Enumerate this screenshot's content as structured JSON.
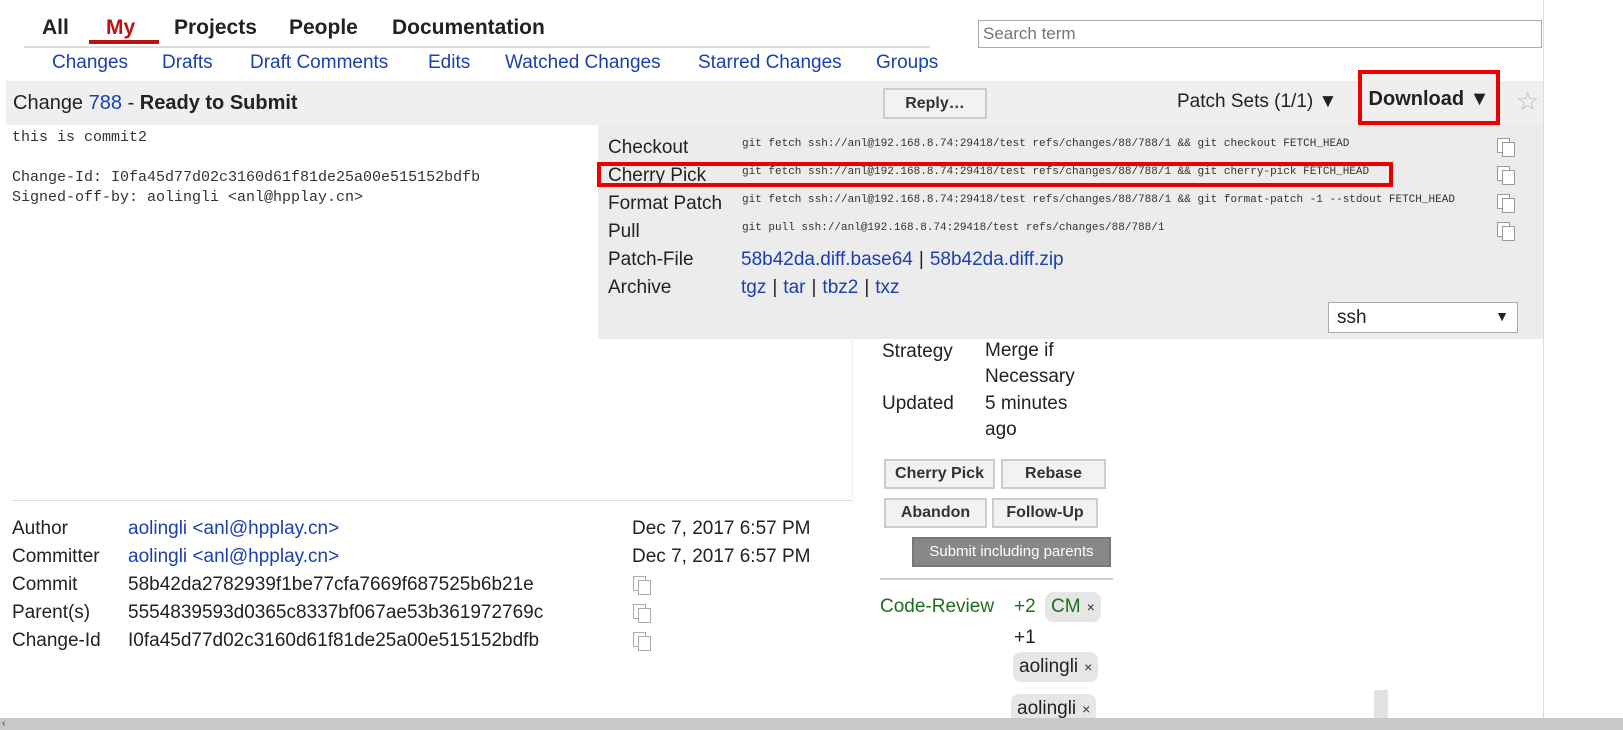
{
  "nav": {
    "tabs": [
      "All",
      "My",
      "Projects",
      "People",
      "Documentation"
    ],
    "active_tab": "My",
    "subtabs": [
      "Changes",
      "Drafts",
      "Draft Comments",
      "Edits",
      "Watched Changes",
      "Starred Changes",
      "Groups"
    ]
  },
  "search": {
    "placeholder": "Search term"
  },
  "change": {
    "label": "Change",
    "number": "788",
    "separator": "-",
    "status": "Ready to Submit",
    "reply_label": "Reply…",
    "patch_sets_label": "Patch Sets (1/1) ▼",
    "download_label": "Download ▼"
  },
  "commit_message": "this is commit2\n\nChange-Id: I0fa45d77d02c3160d61f81de25a00e515152bdfb\nSigned-off-by: aolingli <anl@hpplay.cn>",
  "download": {
    "rows": [
      {
        "label": "Checkout",
        "command": "git fetch ssh://anl@192.168.8.74:29418/test refs/changes/88/788/1 && git checkout FETCH_HEAD"
      },
      {
        "label": "Cherry Pick",
        "command": "git fetch ssh://anl@192.168.8.74:29418/test refs/changes/88/788/1 && git cherry-pick FETCH_HEAD"
      },
      {
        "label": "Format Patch",
        "command": "git fetch ssh://anl@192.168.8.74:29418/test refs/changes/88/788/1 && git format-patch -1 --stdout FETCH_HEAD"
      },
      {
        "label": "Pull",
        "command": "git pull ssh://anl@192.168.8.74:29418/test refs/changes/88/788/1"
      }
    ],
    "patch_file_label": "Patch-File",
    "patch_files": [
      "58b42da.diff.base64",
      "58b42da.diff.zip"
    ],
    "archive_label": "Archive",
    "archives": [
      "tgz",
      "tar",
      "tbz2",
      "txz"
    ],
    "sep": "|",
    "scheme": "ssh"
  },
  "info": {
    "strategy_label": "Strategy",
    "strategy_value": "Merge if Necessary",
    "updated_label": "Updated",
    "updated_value": "5 minutes ago"
  },
  "actions": {
    "cherry_pick": "Cherry Pick",
    "rebase": "Rebase",
    "abandon": "Abandon",
    "follow_up": "Follow-Up",
    "submit_parents": "Submit including parents"
  },
  "review": {
    "label": "Code-Review",
    "plus2": "+2",
    "plus1": "+1",
    "plus2_reviewer": "CM",
    "plus1_reviewers": [
      "aolingli",
      "aolingli"
    ],
    "remove": "×"
  },
  "details": {
    "author_label": "Author",
    "author": "aolingli <anl@hpplay.cn>",
    "author_date": "Dec 7, 2017 6:57 PM",
    "committer_label": "Committer",
    "committer": "aolingli <anl@hpplay.cn>",
    "committer_date": "Dec 7, 2017 6:57 PM",
    "commit_label": "Commit",
    "commit": "58b42da2782939f1be77cfa7669f687525b6b21e",
    "parents_label": "Parent(s)",
    "parents": "5554839593d0365c8337bf067ae53b361972769c",
    "changeid_label": "Change-Id",
    "changeid": "I0fa45d77d02c3160d61f81de25a00e515152bdfb"
  },
  "colors": {
    "accent_red": "#e00000",
    "link_blue": "#1a3fb0",
    "review_green": "#1f6d1f"
  }
}
